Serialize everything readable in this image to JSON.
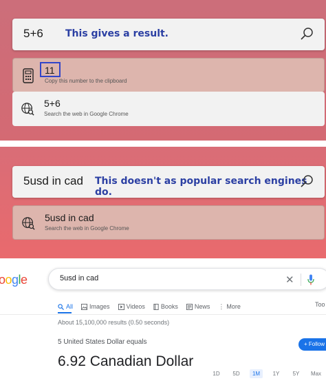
{
  "panel1": {
    "search": {
      "query": "5+6",
      "annotation": "This gives a result."
    },
    "results": [
      {
        "icon": "calculator-icon",
        "title": "11",
        "subtitle": "Copy this number to the clipboard"
      },
      {
        "icon": "globe-search-icon",
        "title": "5+6",
        "subtitle": "Search the web in Google Chrome"
      }
    ]
  },
  "panel2": {
    "search": {
      "query": "5usd in cad",
      "annotation": "This doesn't as popular search engines do."
    },
    "results": [
      {
        "icon": "globe-search-icon",
        "title": "5usd in cad",
        "subtitle": "Search the web in Google Chrome"
      }
    ]
  },
  "google": {
    "logo": "oogle",
    "query": "5usd in cad",
    "tabs": [
      "All",
      "Images",
      "Videos",
      "Books",
      "News",
      "More"
    ],
    "tabs_overflow": "Too",
    "stats": "About 15,100,000 results (0.50 seconds)",
    "conversion_label": "5 United States Dollar equals",
    "conversion_value": "6.92 Canadian Dollar",
    "follow_label": "Follow",
    "ranges": [
      "1D",
      "5D",
      "1M",
      "1Y",
      "5Y",
      "Max"
    ],
    "active_range": "1M"
  }
}
